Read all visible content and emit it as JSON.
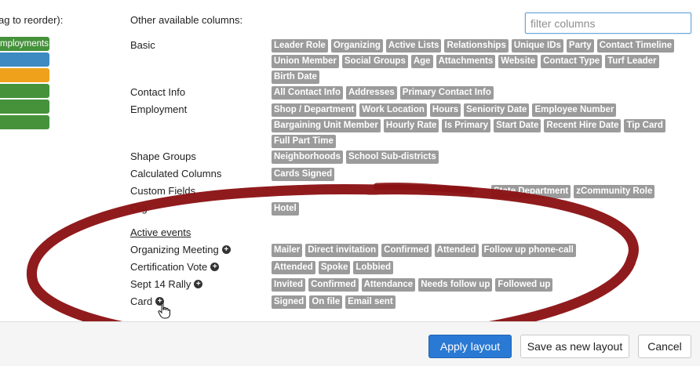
{
  "left_label": "ag to reorder):",
  "selected_columns": [
    {
      "label": "mployments",
      "color": "#45923b"
    },
    {
      "label": "",
      "color": "#3d89c2"
    },
    {
      "label": "",
      "color": "#f0a11b"
    },
    {
      "label": "",
      "color": "#45923b"
    },
    {
      "label": "",
      "color": "#45923b"
    },
    {
      "label": "",
      "color": "#45923b"
    }
  ],
  "other_heading": "Other available columns:",
  "filter": {
    "placeholder": "filter columns",
    "value": ""
  },
  "groups": [
    {
      "label": "Basic",
      "tags": [
        "Leader Role",
        "Organizing",
        "Active Lists",
        "Relationships",
        "Unique IDs",
        "Party",
        "Contact Timeline",
        "Union Member",
        "Social Groups",
        "Age",
        "Attachments",
        "Website",
        "Contact Type",
        "Turf Leader",
        "Birth Date"
      ]
    },
    {
      "label": "Contact Info",
      "tags": [
        "All Contact Info",
        "Addresses",
        "Primary Contact Info"
      ]
    },
    {
      "label": "Employment",
      "tags": [
        "Shop / Department",
        "Work Location",
        "Hours",
        "Seniority Date",
        "Employee Number",
        "Bargaining Unit Member",
        "Hourly Rate",
        "Is Primary",
        "Start Date",
        "Recent Hire Date",
        "Tip Card",
        "Full Part Time"
      ]
    },
    {
      "label": "Shape Groups",
      "tags": [
        "Neighborhoods",
        "School Sub-districts"
      ]
    },
    {
      "label": "Calculated Columns",
      "tags": [
        "Cards Signed"
      ]
    },
    {
      "label": "Custom Fields",
      "tags": [
        "State Department",
        "zCommunity Role"
      ]
    },
    {
      "label": "Org",
      "tags": [
        "Hotel"
      ]
    }
  ],
  "active_events_heading": "Active events",
  "events": [
    {
      "label": "Organizing Meeting",
      "tags": [
        "Mailer",
        "Direct invitation",
        "Confirmed",
        "Attended",
        "Follow up phone-call"
      ]
    },
    {
      "label": "Certification Vote",
      "tags": [
        "Attended",
        "Spoke",
        "Lobbied"
      ]
    },
    {
      "label": "Sept 14 Rally",
      "tags": [
        "Invited",
        "Confirmed",
        "Attendance",
        "Needs follow up",
        "Followed up"
      ]
    },
    {
      "label": "Card",
      "tags": [
        "Signed",
        "On file",
        "Email sent"
      ]
    }
  ],
  "plus_glyph": "+",
  "footer": {
    "apply_label": "Apply layout",
    "save_label": "Save as new layout",
    "cancel_label": "Cancel"
  },
  "colors": {
    "tag_bg": "#9b9b9b",
    "accent": "#2a79d4",
    "annotation": "#8b1214"
  }
}
